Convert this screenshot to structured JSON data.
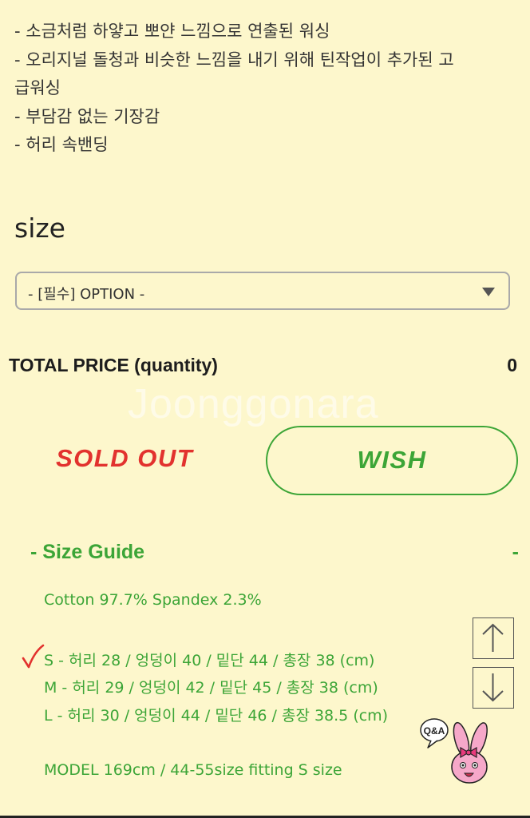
{
  "description": {
    "lines": [
      "- 소금처럼 하얗고 뽀얀 느낌으로 연출된 워싱",
      "- 오리지널 돌청과 비슷한 느낌을 내기 위해 틴작업이 추가된 고",
      "급워싱",
      "- 부담감 없는 기장감",
      "- 허리 속밴딩"
    ]
  },
  "size_section": {
    "heading": "size",
    "option_value": "- [필수] OPTION -"
  },
  "total": {
    "label": "TOTAL PRICE (quantity)",
    "value": "0"
  },
  "watermark": "Joonggonara",
  "actions": {
    "soldout_label": "SOLD OUT",
    "wish_label": "WISH"
  },
  "size_guide": {
    "title": "- Size Guide",
    "toggle": "-",
    "fabric": "Cotton 97.7% Spandex 2.3%",
    "sizes": [
      "S - 허리 28 / 엉덩이 40 / 밑단 44 / 총장 38 (cm)",
      "M - 허리 29 / 엉덩이 42 / 밑단 45 / 총장 38 (cm)",
      "L - 허리 30 / 엉덩이 44 / 밑단 46 / 총장 38.5 (cm)"
    ],
    "model": "MODEL 169cm / 44-55size fitting S size"
  },
  "qa_badge": {
    "text": "Q&A"
  },
  "colors": {
    "background": "#fdf7cc",
    "green": "#3ca537",
    "red": "#e2322e"
  },
  "icons": {
    "select_caret": "caret-down-icon",
    "scroll_up": "arrow-up-icon",
    "scroll_down": "arrow-down-icon",
    "check": "checkmark-icon"
  }
}
